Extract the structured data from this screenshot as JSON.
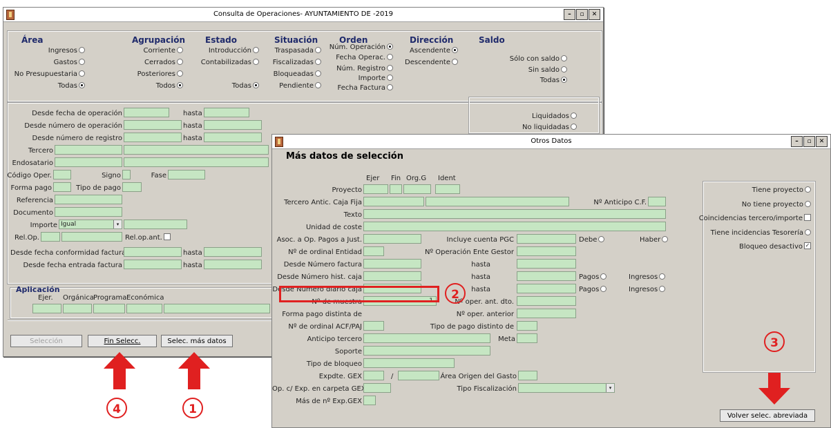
{
  "main_window": {
    "title": "Consulta de Operaciones-      AYUNTAMIENTO DE          -2019",
    "area": {
      "heading": "Área",
      "options": [
        "Ingresos",
        "Gastos",
        "No Presupuestaria",
        "Todas"
      ],
      "selected": "Todas"
    },
    "agrupacion": {
      "heading": "Agrupación",
      "options": [
        "Corriente",
        "Cerrados",
        "Posteriores",
        "Todos"
      ],
      "selected": "Todos"
    },
    "estado": {
      "heading": "Estado",
      "options": [
        "Introducción",
        "Contabilizadas",
        "Todas"
      ],
      "selected": "Todas"
    },
    "situacion": {
      "heading": "Situación",
      "options": [
        "Traspasada",
        "Fiscalizadas",
        "Bloqueadas",
        "Pendiente"
      ]
    },
    "orden": {
      "heading": "Orden",
      "options": [
        "Núm. Operación",
        "Fecha Operac.",
        "Núm. Registro",
        "Importe",
        "Fecha Factura"
      ],
      "selected": "Núm. Operación"
    },
    "direccion": {
      "heading": "Dirección",
      "options": [
        "Ascendente",
        "Descendente"
      ],
      "selected": "Ascendente"
    },
    "saldo": {
      "heading": "Saldo",
      "options": [
        "Sólo con saldo",
        "Sin saldo",
        "Todas"
      ],
      "selected": "Todas"
    },
    "liquidacion": {
      "options": [
        "Liquidados",
        "No liquidadas"
      ]
    },
    "filters": {
      "desde_fecha_operacion": "Desde fecha de operación",
      "desde_numero_operacion": "Desde número de operación",
      "desde_numero_registro": "Desde número de registro",
      "hasta": "hasta",
      "tercero": "Tercero",
      "endosatario": "Endosatario",
      "codigo_oper": "Código Oper.",
      "signo": "Signo",
      "fase": "Fase",
      "forma_pago": "Forma pago",
      "tipo_pago": "Tipo de pago",
      "referencia": "Referencia",
      "documento": "Documento",
      "importe": "Importe",
      "importe_value": "Igual",
      "rel_op": "Rel.Op.",
      "rel_op_ant": "Rel.op.ant.",
      "desde_fecha_conformidad": "Desde fecha conformidad factura",
      "desde_fecha_entrada": "Desde fecha entrada factura"
    },
    "aplicacion": {
      "heading": "Aplicación",
      "columns": [
        "Ejer.",
        "Orgánica",
        "Programa",
        "Económica"
      ]
    },
    "buttons": {
      "seleccion": "Selección",
      "fin_selecc": "Fin Selecc.",
      "selec_mas_datos": "Selec. más datos"
    }
  },
  "otros_window": {
    "title": "Otros Datos",
    "heading": "Más datos de selección",
    "col_heads": [
      "Ejer",
      "Fin",
      "Org.G",
      "Ident"
    ],
    "labels": {
      "proyecto": "Proyecto",
      "tercero_antic": "Tercero Antic. Caja Fija",
      "n_anticipo": "Nº Anticipo C.F.",
      "texto": "Texto",
      "unidad_coste": "Unidad de coste",
      "asoc_op": "Asoc. a Op. Pagos a Just.",
      "incluye_pgc": "Incluye cuenta PGC",
      "debe": "Debe",
      "haber": "Haber",
      "ordinal_entidad": "Nº de ordinal Entidad",
      "op_ente_gestor": "Nº Operación Ente Gestor",
      "desde_num_factura": "Desde Número factura",
      "hasta": "hasta",
      "desde_hist_caja": "Desde Número hist. caja",
      "pagos": "Pagos",
      "ingresos": "Ingresos",
      "desde_diario_caja": "Desde Número diario caja",
      "n_muestra": "Nº de muestra",
      "n_muestra_value": "1",
      "n_oper_ant_dto": "Nº oper. ant. dto.",
      "forma_pago_distinta": "Forma pago distinta de",
      "n_oper_anterior": "Nº oper. anterior",
      "ordinal_acf": "Nº de ordinal ACF/PAJ",
      "tipo_pago_distinto": "Tipo de pago distinto de",
      "anticipo_tercero": "Anticipo tercero",
      "meta": "Meta",
      "soporte": "Soporte",
      "tipo_bloqueo": "Tipo de bloqueo",
      "expdte_gex": "Expdte. GEX",
      "slash": "/",
      "area_origen": "Área Origen del Gasto",
      "op_exp_carpeta": "Op. c/ Exp. en carpeta GEX",
      "tipo_fiscalizacion": "Tipo Fiscalización",
      "mas_de_exp": "Más de nº Exp.GEX"
    },
    "right_options": [
      "Tiene proyecto",
      "No tiene proyecto",
      "Coincidencias tercero/importe",
      "Tiene incidencias Tesorería",
      "Bloqueo desactivo"
    ],
    "volver_button": "Volver selec. abreviada"
  },
  "annotations": {
    "c1": "1",
    "c2": "2",
    "c3": "3",
    "c4": "4"
  },
  "colors": {
    "field": "#c6e6c3",
    "annotation": "#e02020",
    "heading": "#1f2a6b"
  }
}
